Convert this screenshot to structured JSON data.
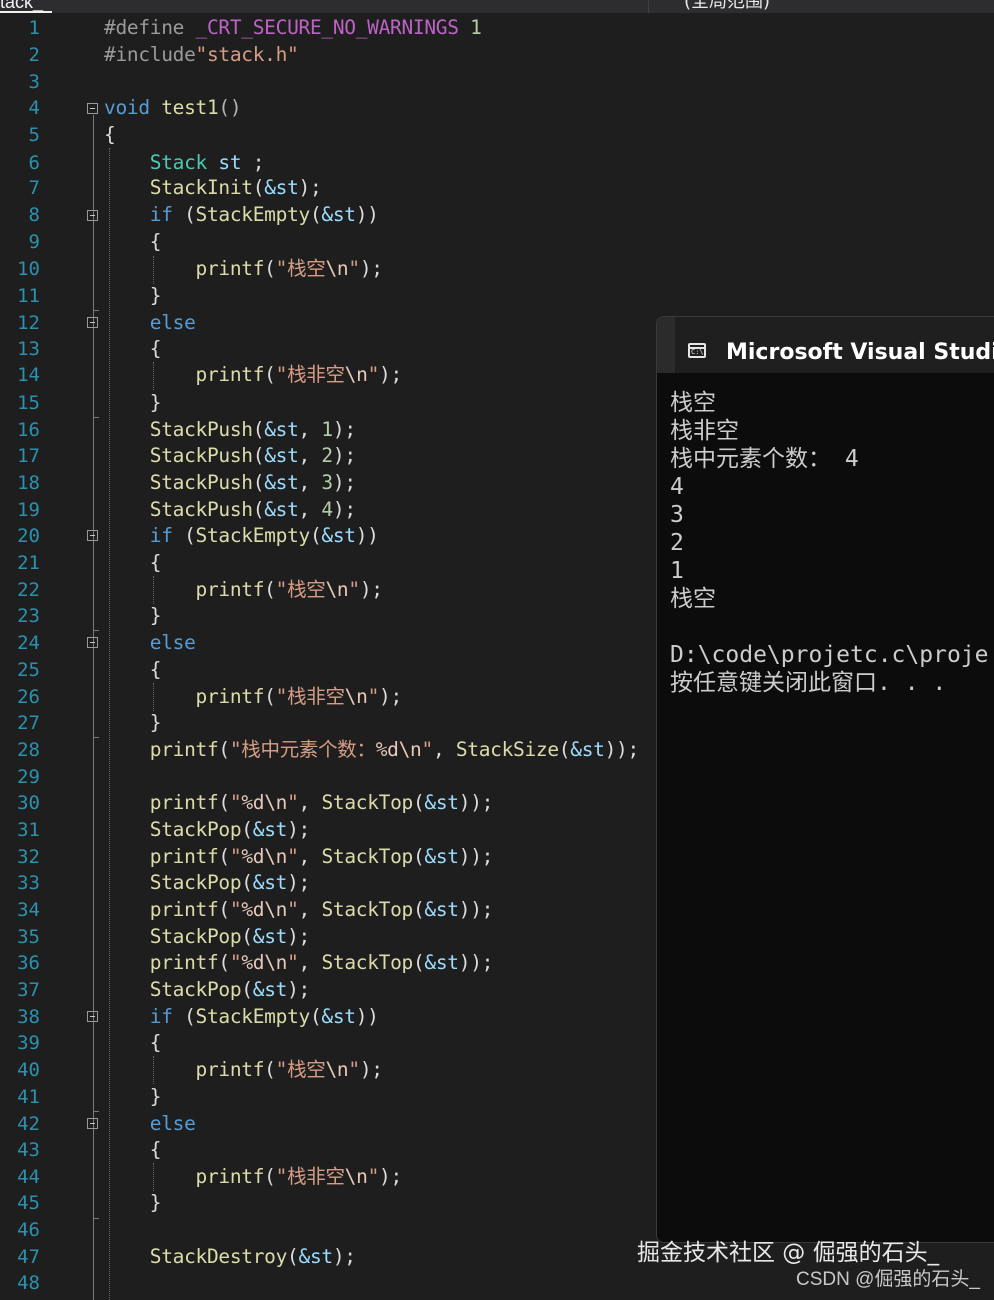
{
  "tabs": {
    "left_tab": "tack_",
    "right_tab": "(全局范围)"
  },
  "colors": {
    "editor_bg": "#1e1e1e",
    "line_number": "#2b91af",
    "keyword": "#569cd6",
    "string": "#d69d85",
    "type": "#4ec9b0",
    "console_bg": "#0c0c0c"
  },
  "line_numbers": [
    "1",
    "2",
    "3",
    "4",
    "5",
    "6",
    "7",
    "8",
    "9",
    "10",
    "11",
    "12",
    "13",
    "14",
    "15",
    "16",
    "17",
    "18",
    "19",
    "20",
    "21",
    "22",
    "23",
    "24",
    "25",
    "26",
    "27",
    "28",
    "29",
    "30",
    "31",
    "32",
    "33",
    "34",
    "35",
    "36",
    "37",
    "38",
    "39",
    "40",
    "41",
    "42",
    "43",
    "44",
    "45",
    "46",
    "47",
    "48"
  ],
  "code": {
    "define_kw": "#define",
    "define_macro": "_CRT_SECURE_NO_WARNINGS",
    "define_val": "1",
    "include_kw": "#include",
    "include_file": "\"stack.h\"",
    "void_kw": "void",
    "func_name": "test1",
    "parens": "()",
    "brace_open": "{",
    "brace_close": "}",
    "type_stack": "Stack",
    "var_st": "st",
    "semi": ";",
    "stack_init": "StackInit",
    "amp_st": "&st",
    "if_kw": "if",
    "else_kw": "else",
    "stack_empty": "StackEmpty",
    "printf_fn": "printf",
    "str_empty_pre": "\"栈空",
    "str_nonempty_pre": "\"栈非空",
    "esc_n": "\\n",
    "quote": "\"",
    "stack_push": "StackPush",
    "n1": "1",
    "n2": "2",
    "n3": "3",
    "n4": "4",
    "str_count_pre": "\"栈中元素个数：",
    "fmt_d": "%d",
    "stack_size": "StackSize",
    "stack_top": "StackTop",
    "stack_pop": "StackPop",
    "stack_destroy": "StackDestroy"
  },
  "console": {
    "title": "Microsoft Visual Studio",
    "lines": [
      "栈空",
      "栈非空",
      "栈中元素个数： 4",
      "4",
      "3",
      "2",
      "1",
      "栈空",
      "",
      "D:\\code\\projetc.c\\proje",
      "按任意键关闭此窗口. . ."
    ]
  },
  "watermark": {
    "juejin": "掘金技术社区 @ 倔强的石头_",
    "csdn": "CSDN @倔强的石头_"
  }
}
